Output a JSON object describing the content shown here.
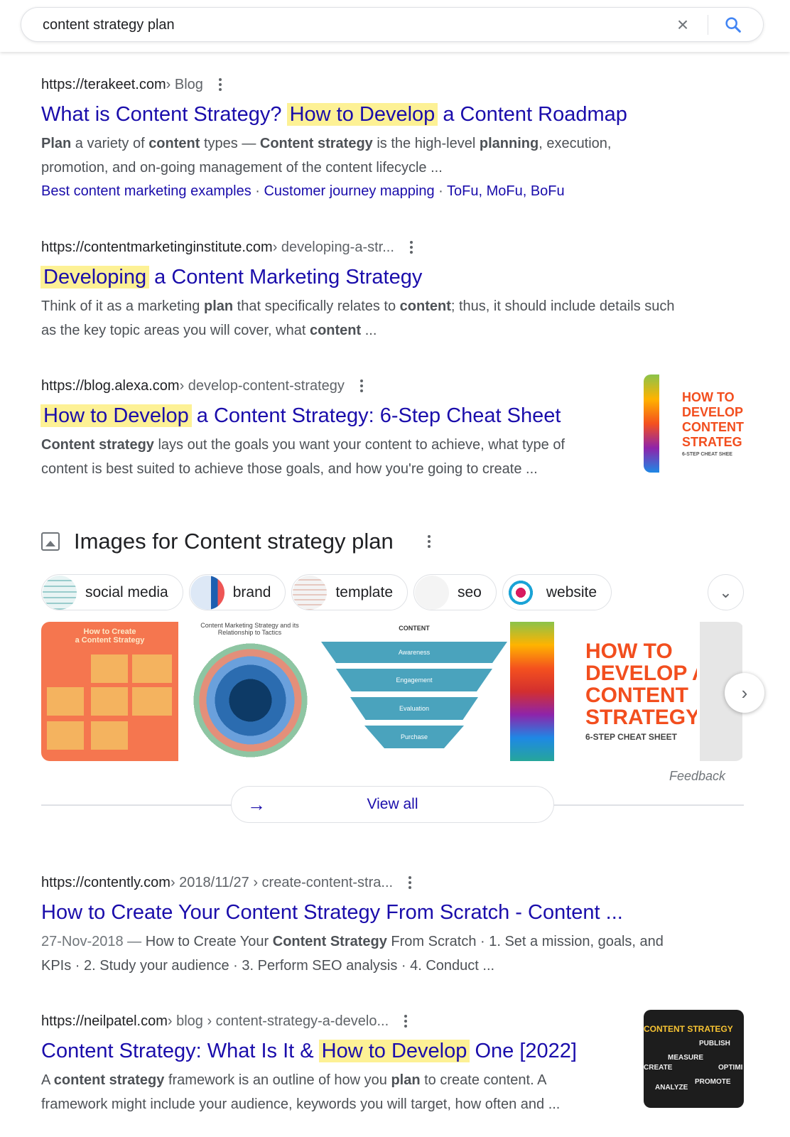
{
  "search": {
    "query": "content strategy plan",
    "clear_icon": "close-icon",
    "search_icon": "search-icon"
  },
  "colors": {
    "link": "#1a0dab",
    "highlight": "#fdf195",
    "accent": "#4285f4"
  },
  "results": [
    {
      "url": "https://terakeet.com",
      "crumb": " › Blog",
      "title_pre": "What is Content Strategy? ",
      "title_hl": "How to Develop",
      "title_post": " a Content Roadmap",
      "snippet": [
        [
          "b",
          "Plan"
        ],
        [
          "t",
          " a variety of "
        ],
        [
          "b",
          "content"
        ],
        [
          "t",
          " types — "
        ],
        [
          "b",
          "Content strategy"
        ],
        [
          "t",
          " is the high-level "
        ],
        [
          "b",
          "planning"
        ],
        [
          "t",
          ", execution, promotion, and on-going management of the content lifecycle ..."
        ]
      ],
      "sitelinks": [
        "Best content marketing examples",
        "Customer journey mapping",
        "ToFu, MoFu, BoFu"
      ]
    },
    {
      "url": "https://contentmarketinginstitute.com",
      "crumb": " › developing-a-str...",
      "title_pre": "",
      "title_hl": "Developing",
      "title_post": " a Content Marketing Strategy",
      "snippet": [
        [
          "t",
          "Think of it as a marketing "
        ],
        [
          "b",
          "plan"
        ],
        [
          "t",
          " that specifically relates to "
        ],
        [
          "b",
          "content"
        ],
        [
          "t",
          "; thus, it should include details such as the key topic areas you will cover, what "
        ],
        [
          "b",
          "content"
        ],
        [
          "t",
          " ..."
        ]
      ]
    },
    {
      "url": "https://blog.alexa.com",
      "crumb": " › develop-content-strategy",
      "title_pre": "",
      "title_hl": "How to Develop",
      "title_post": " a Content Strategy: 6-Step Cheat Sheet",
      "snippet": [
        [
          "b",
          "Content strategy"
        ],
        [
          "t",
          " lays out the goals you want your content to achieve, what type of content is best suited to achieve those goals, and how you're going to create ..."
        ]
      ],
      "thumb_text": [
        "HOW TO",
        "DEVELOP",
        "CONTENT",
        "STRATEG",
        "6-STEP CHEAT SHEE"
      ]
    },
    {
      "url": "https://contently.com",
      "crumb": " › 2018/11/27 › create-content-stra...",
      "title_pre": "How to Create Your Content Strategy From Scratch - Content ...",
      "title_hl": "",
      "title_post": "",
      "snippet": [
        [
          "d",
          "27-Nov-2018 — "
        ],
        [
          "t",
          "How to Create Your "
        ],
        [
          "b",
          "Content Strategy"
        ],
        [
          "t",
          " From Scratch · 1. Set a mission, goals, and KPIs · 2. Study your audience · 3. Perform SEO analysis · 4. Conduct ..."
        ]
      ]
    },
    {
      "url": "https://neilpatel.com",
      "crumb": " › blog › content-strategy-a-develo...",
      "title_pre": "Content Strategy: What Is It & ",
      "title_hl": "How to Develop",
      "title_post": " One [2022]",
      "snippet": [
        [
          "t",
          "A "
        ],
        [
          "b",
          "content strategy"
        ],
        [
          "t",
          " framework is an outline of how you "
        ],
        [
          "b",
          "plan"
        ],
        [
          "t",
          " to create content. A framework might include your audience, keywords you will target, how often and ..."
        ]
      ],
      "thumb_text": [
        "CONTENT STRATEGY",
        "PUBLISH",
        "MEASURE",
        "CREATE",
        "OPTIMI",
        "ANALYZE",
        "PROMOTE"
      ]
    }
  ],
  "images": {
    "heading": "Images for Content strategy plan",
    "chips": [
      "social media",
      "brand",
      "template",
      "seo",
      "website"
    ],
    "gallery": [
      {
        "lines": [
          "How to Create",
          "a Content Strategy"
        ]
      },
      {
        "lines": [
          "Content Marketing Strategy and its",
          "Relationship to Tactics"
        ]
      },
      {
        "lines": [
          "CONTENT",
          "Awareness",
          "Engagement",
          "Evaluation",
          "Purchase"
        ]
      },
      {
        "lines": [
          "HOW TO",
          "DEVELOP A",
          "CONTENT",
          "STRATEGY",
          "6-STEP CHEAT SHEET"
        ]
      }
    ],
    "feedback": "Feedback",
    "view_all": "View all"
  }
}
